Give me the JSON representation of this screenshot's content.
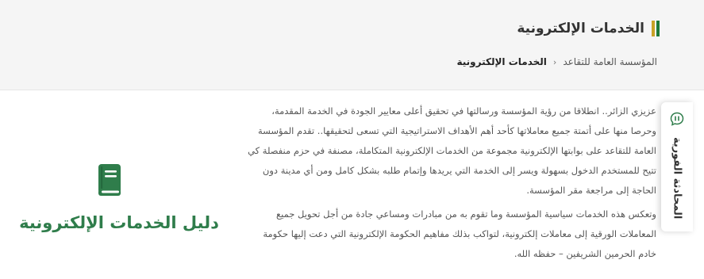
{
  "header": {
    "title": "الخدمات الإلكترونية",
    "accent_colors": [
      "#1f7a3a",
      "#c9a227"
    ]
  },
  "breadcrumb": {
    "items": [
      {
        "label": "المؤسسة العامة للتقاعد"
      },
      {
        "label": "الخدمات الإلكترونية"
      }
    ],
    "separator": "‹"
  },
  "intro": {
    "paragraph1": "عزيزي الزائر.. انطلاقا من رؤية المؤسسة ورسالتها في تحقيق أعلى معايير الجودة في الخدمة المقدمة، وحرصا منها على أتمتة جميع معاملاتها كأحد أهم الأهداف الاستراتيجية التي تسعى لتحقيقها.. تقدم المؤسسة العامة للتقاعد على بوابتها الإلكترونية مجموعة من الخدمات الإلكترونية المتكاملة، مصنفة في حزم منفصلة كي تتيح للمستخدم الدخول بسهولة ويسر إلى الخدمة التي يريدها وإتمام طلبه بشكل كامل ومن أي مدينة دون الحاجة إلى مراجعة مقر المؤسسة.",
    "paragraph2": "وتعكس هذه الخدمات سياسية المؤسسة وما تقوم به من مبادرات ومساعي جادة من أجل تحويل جميع المعاملات الورقية إلى معاملات إلكترونية، لتواكب بذلك مفاهيم الحكومة الإلكترونية التي دعت إليها حكومة خادم الحرمين الشريفين – حفظه الله."
  },
  "guide": {
    "label": "دليل الخدمات الإلكترونية",
    "icon": "book-icon",
    "color": "#2f7d4b"
  },
  "chat": {
    "label": "المحادثة الفورية",
    "icon": "chat-icon",
    "color": "#2f7d4b"
  }
}
